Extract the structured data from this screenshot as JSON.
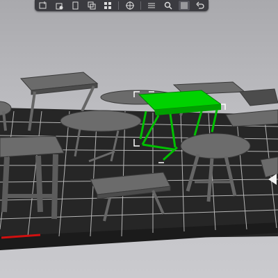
{
  "app": {
    "accent_color": "#00c800",
    "bed_color": "#2e2e2e",
    "grid_color": "#d8d8d8",
    "object_color": "#5a5a5a",
    "selected_color": "#00d200",
    "background_color": "#bdbdc1"
  },
  "toolbar": {
    "buttons": [
      {
        "id": "add",
        "icon": "add-object-icon"
      },
      {
        "id": "delete",
        "icon": "delete-icon"
      },
      {
        "id": "copy",
        "icon": "copy-icon"
      },
      {
        "id": "paste",
        "icon": "paste-icon"
      },
      {
        "id": "arrange",
        "icon": "arrange-icon"
      },
      {
        "id": "split",
        "icon": "split-icon"
      },
      {
        "id": "layers",
        "icon": "layers-icon"
      },
      {
        "id": "search",
        "icon": "search-icon"
      },
      {
        "id": "variable-layer",
        "icon": "variable-layer-icon"
      },
      {
        "id": "undo",
        "icon": "undo-icon"
      }
    ]
  },
  "scene": {
    "object_count": 11,
    "selected_object": "table-selected-green"
  }
}
